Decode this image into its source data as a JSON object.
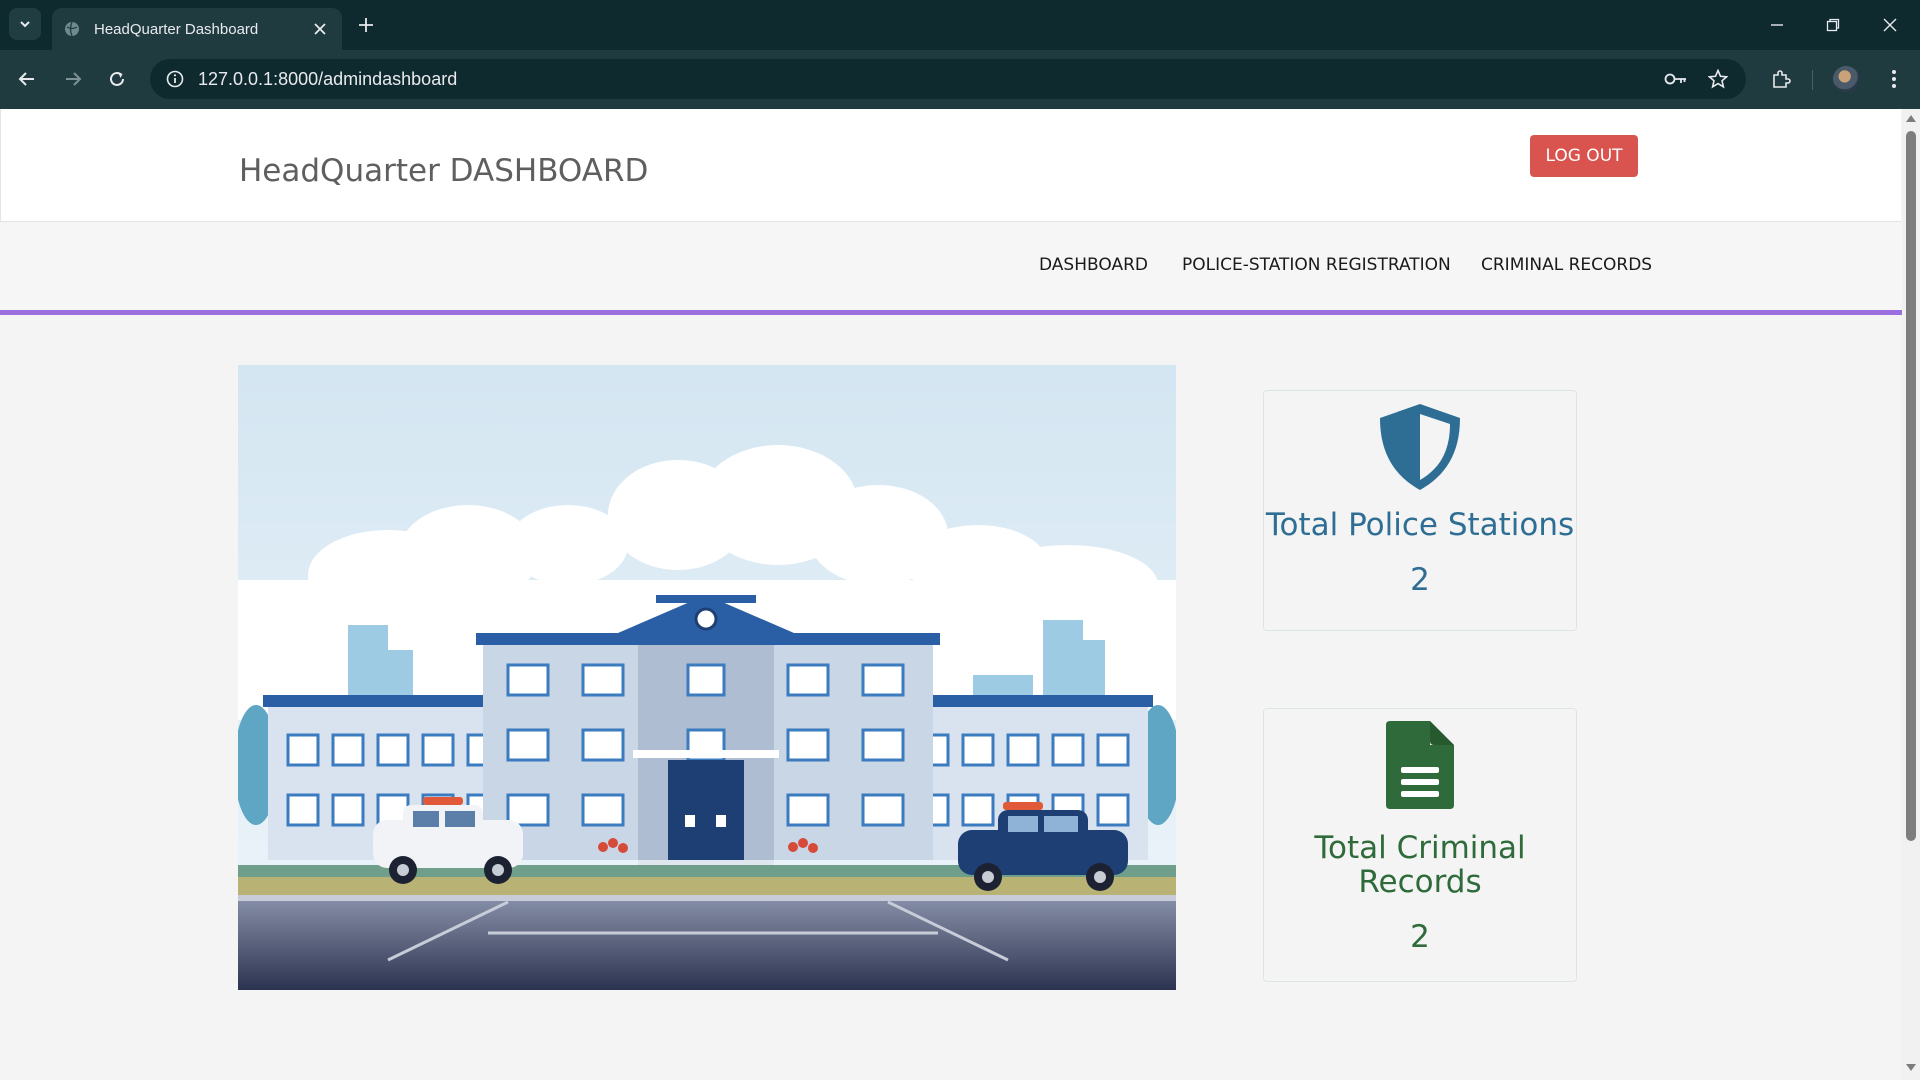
{
  "browser": {
    "tab_title": "HeadQuarter Dashboard",
    "url": "127.0.0.1:8000/admindashboard"
  },
  "header": {
    "title": "HeadQuarter DASHBOARD",
    "logout_label": "LOG OUT"
  },
  "nav": {
    "items": [
      {
        "label": "DASHBOARD"
      },
      {
        "label": "POLICE-STATION REGISTRATION"
      },
      {
        "label": "CRIMINAL RECORDS"
      }
    ]
  },
  "cards": {
    "police_stations": {
      "label": "Total Police Stations",
      "value": "2",
      "color": "#2e6e94",
      "icon": "shield-icon"
    },
    "criminal_records": {
      "label": "Total Criminal Records",
      "value": "2",
      "color": "#2f6b3a",
      "icon": "document-icon"
    }
  },
  "colors": {
    "logout": "#d9534f",
    "nav_underline": "#9b6fe0",
    "chrome_dark": "#0e2a2f",
    "chrome_toolbar": "#1f3b40"
  }
}
